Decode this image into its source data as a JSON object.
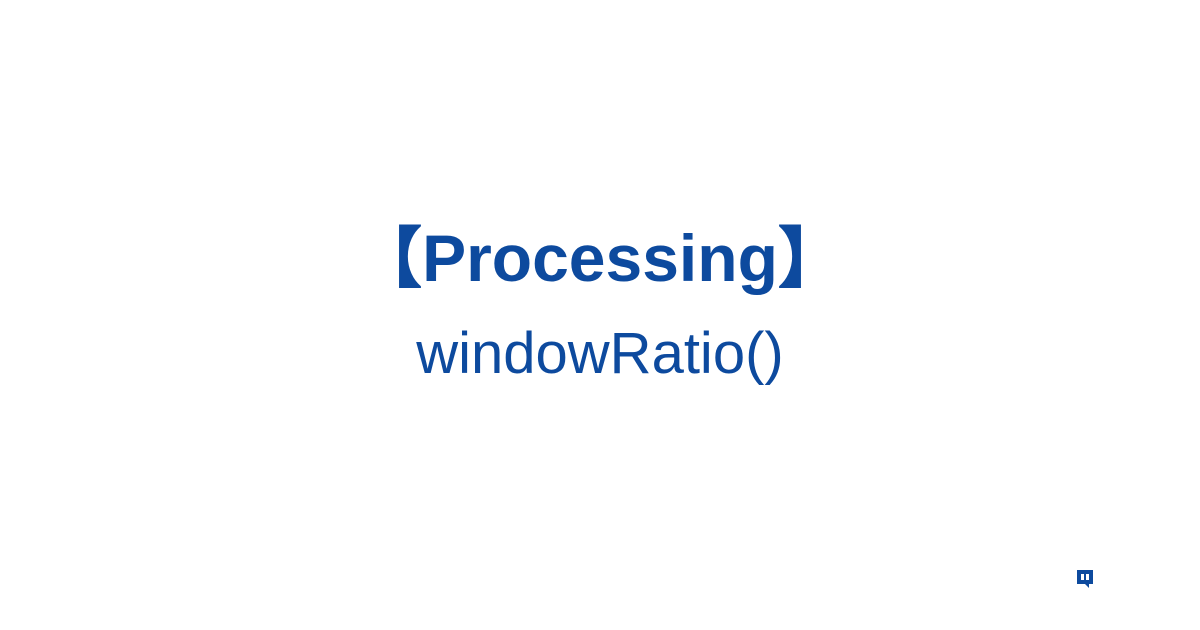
{
  "title": "【Processing】",
  "subtitle": "windowRatio()",
  "colors": {
    "text": "#0d4a9e",
    "background": "#ffffff",
    "logo": "#0d4a9e"
  }
}
